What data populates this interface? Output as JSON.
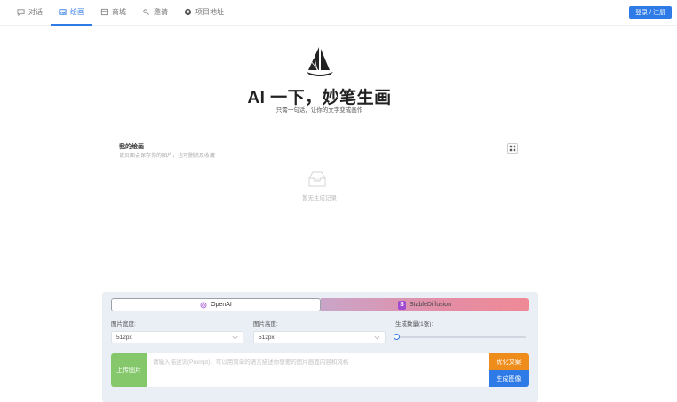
{
  "nav": {
    "items": [
      {
        "label": "对话",
        "icon": "chat-icon"
      },
      {
        "label": "绘画",
        "icon": "image-icon"
      },
      {
        "label": "商城",
        "icon": "shop-icon"
      },
      {
        "label": "邀请",
        "icon": "invite-icon"
      },
      {
        "label": "项目地址",
        "icon": "github-icon"
      }
    ],
    "active_index": 1,
    "login_label": "登录 / 注册"
  },
  "hero": {
    "title": "AI 一下，妙笔生画",
    "subtitle": "只需一句话，让你的文字变成画作"
  },
  "my_paintings": {
    "title": "我的绘画",
    "description": "该页面会保存你的图片，也可删除及收藏",
    "empty_text": "暂无生成记录"
  },
  "panel": {
    "providers": [
      "OpenAI",
      "StableDiffusion"
    ],
    "active_provider": 0,
    "width_label": "图片宽度:",
    "width_value": "512px",
    "height_label": "图片高度:",
    "height_value": "512px",
    "count_label": "生成数量(1张):",
    "count_value": 1,
    "upload_label": "上传图片",
    "prompt_placeholder": "请输入描述词(Prompt)，可以用简单的语言描述你想要的图片画面内容和风格",
    "optimize_label": "优化文案",
    "generate_label": "生成图像"
  },
  "colors": {
    "accent": "#2e7ae6",
    "upload": "#85c86b",
    "optimize": "#ef8d1c",
    "panel_bg": "#eaeef5"
  }
}
